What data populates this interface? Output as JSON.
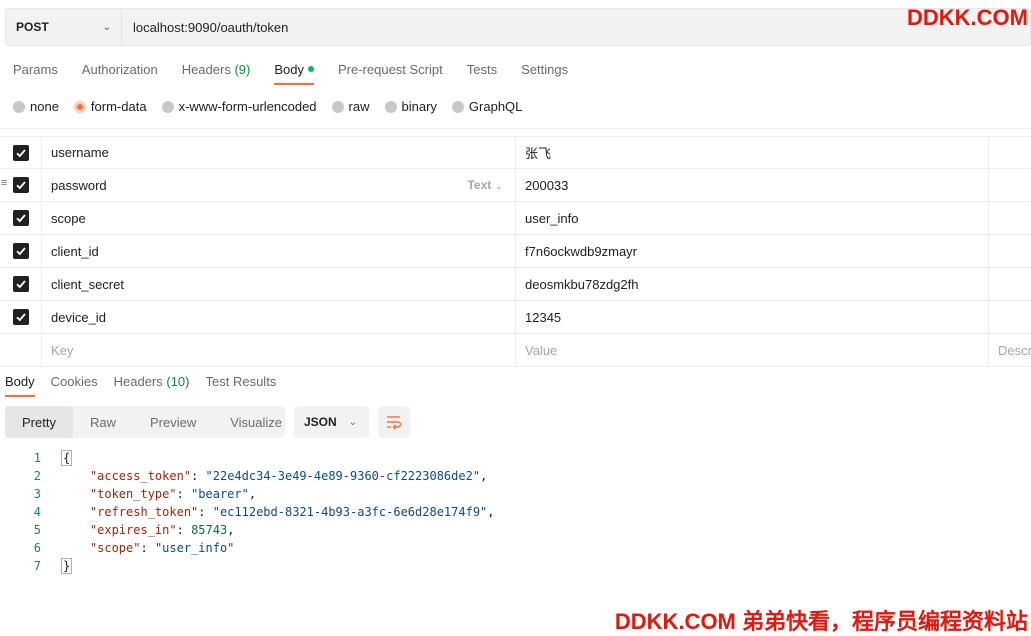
{
  "request": {
    "method": "POST",
    "url": "localhost:9090/oauth/token"
  },
  "watermark": {
    "top": "DDKK.COM",
    "bottom": "DDKK.COM 弟弟快看，程序员编程资料站"
  },
  "request_tabs": [
    {
      "label": "Params"
    },
    {
      "label": "Authorization"
    },
    {
      "label": "Headers",
      "count": "(9)"
    },
    {
      "label": "Body"
    },
    {
      "label": "Pre-request Script"
    },
    {
      "label": "Tests"
    },
    {
      "label": "Settings"
    }
  ],
  "body_types": [
    "none",
    "form-data",
    "x-www-form-urlencoded",
    "raw",
    "binary",
    "GraphQL"
  ],
  "body_type_selected": "form-data",
  "params": [
    {
      "key": "username",
      "value": "张飞"
    },
    {
      "key": "password",
      "value": "200033",
      "type": "Text"
    },
    {
      "key": "scope",
      "value": "user_info"
    },
    {
      "key": "client_id",
      "value": "f7n6ockwdb9zmayr"
    },
    {
      "key": "client_secret",
      "value": "deosmkbu78zdg2fh"
    },
    {
      "key": "device_id",
      "value": "12345"
    }
  ],
  "params_placeholder": {
    "key": "Key",
    "value": "Value",
    "description": "Description"
  },
  "response_tabs": [
    {
      "label": "Body"
    },
    {
      "label": "Cookies"
    },
    {
      "label": "Headers",
      "count": "(10)"
    },
    {
      "label": "Test Results"
    }
  ],
  "view_modes": [
    "Pretty",
    "Raw",
    "Preview",
    "Visualize"
  ],
  "view_selected": "Pretty",
  "format": "JSON",
  "response_lines": [
    {
      "no": "1",
      "text": "{"
    },
    {
      "no": "2",
      "key": "\"access_token\"",
      "value": "\"22e4dc34-3e49-4e89-9360-cf2223086de2\"",
      "tail": ","
    },
    {
      "no": "3",
      "key": "\"token_type\"",
      "value": "\"bearer\"",
      "tail": ","
    },
    {
      "no": "4",
      "key": "\"refresh_token\"",
      "value": "\"ec112ebd-8321-4b93-a3fc-6e6d28e174f9\"",
      "tail": ","
    },
    {
      "no": "5",
      "key": "\"expires_in\"",
      "num": "85743",
      "tail": ","
    },
    {
      "no": "6",
      "key": "\"scope\"",
      "value": "\"user_info\"",
      "tail": ""
    },
    {
      "no": "7",
      "text": "}"
    }
  ],
  "colors": {
    "accent": "#ff6c37",
    "watermark": "#e8150c",
    "count_green": "#0c8d3a"
  }
}
